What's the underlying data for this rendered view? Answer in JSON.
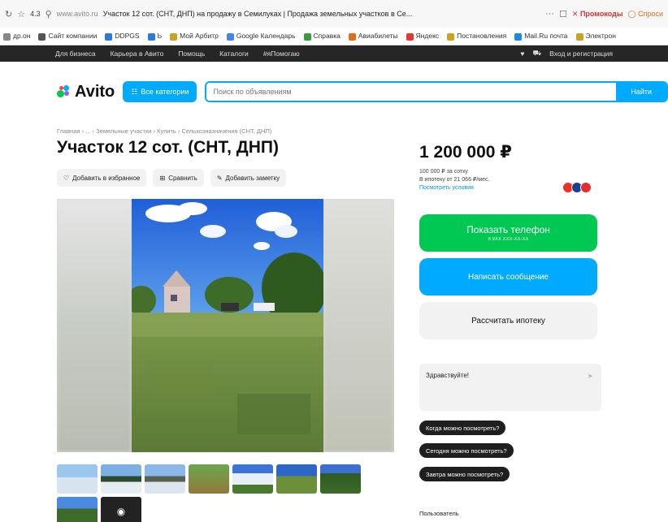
{
  "browser": {
    "rating": "4.3",
    "url": "www.avito.ru",
    "tab_title": "Участок 12 сот. (СНТ, ДНП) на продажу в Семилуках | Продажа земельных участков в Се...",
    "promo1": "Промокоды",
    "promo2": "Спроси"
  },
  "bookmarks": [
    {
      "label": "др.он",
      "color": "#888"
    },
    {
      "label": "Сайт компании",
      "color": "#555"
    },
    {
      "label": "DDPGS",
      "color": "#2b7bd8"
    },
    {
      "label": "Ь",
      "color": "#2b7bd8"
    },
    {
      "label": "Мой Арбитр",
      "color": "#c9a227"
    },
    {
      "label": "Google Календарь",
      "color": "#4285f4"
    },
    {
      "label": "Справка",
      "color": "#3b9c3b"
    },
    {
      "label": "Авиабилеты",
      "color": "#e46b17"
    },
    {
      "label": "Яндекс",
      "color": "#e53935"
    },
    {
      "label": "Постановления",
      "color": "#c9a227"
    },
    {
      "label": "Mail.Ru почта",
      "color": "#1e88e5"
    },
    {
      "label": "Электрон",
      "color": "#c9a227"
    }
  ],
  "topnav": {
    "items": [
      "Для бизнеса",
      "Карьера в Авито",
      "Помощь",
      "Каталоги",
      "#яПомогаю"
    ],
    "login": "Вход и регистрация"
  },
  "header": {
    "logo": "Avito",
    "categories_label": "Все категории",
    "search_placeholder": "Поиск по объявлениям",
    "search_button": "Найти"
  },
  "breadcrumb": "Главная › ... › Земельные участки › Купить › Сельхозназначения (СНТ, ДНП)",
  "title": "Участок 12 сот. (СНТ, ДНП)",
  "actions": {
    "favorite": "Добавить в избранное",
    "compare": "Сравнить",
    "note": "Добавить заметку"
  },
  "price": {
    "value": "1 200 000 ₽",
    "per_sotka": "100 000 ₽ за сотку",
    "mortgage": "В ипотеку от 21 066 ₽/мес.",
    "offers_link": "Посмотреть условия"
  },
  "buttons": {
    "phone": "Показать телефон",
    "phone_sub": "8 9XX XXX-XX-XX",
    "message": "Написать сообщение",
    "mortgage": "Рассчитать ипотеку"
  },
  "chat": {
    "greeting": "Здравствуйте!"
  },
  "quick_questions": [
    "Когда можно посмотреть?",
    "Сегодня можно посмотреть?",
    "Завтра можно посмотреть?"
  ],
  "seller_label": "Пользователь",
  "colors": {
    "accent_blue": "#00aaff",
    "phone_green": "#00c853",
    "dark_nav": "#262626"
  }
}
